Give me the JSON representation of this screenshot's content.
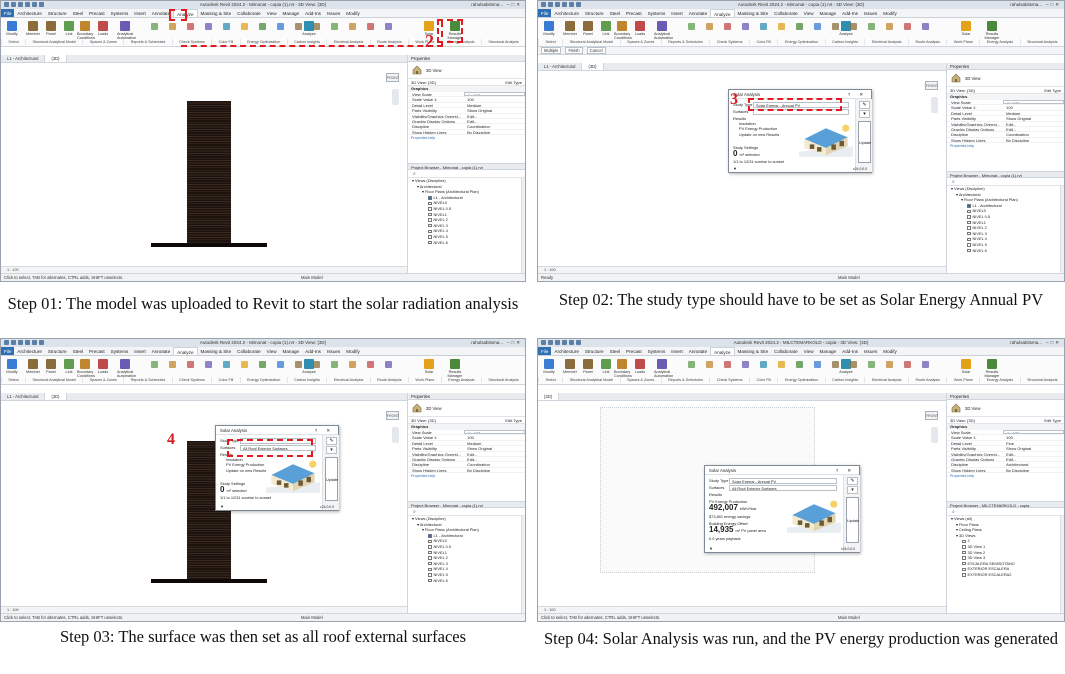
{
  "shared": {
    "window_title": "Autodesk Revit 2024.2 - Mimonat - copia (1).rvt - 3D View: {3D}",
    "user": "rahulsabitsma...",
    "menu_tabs": [
      "File",
      "Architecture",
      "Structure",
      "Steel",
      "Precast",
      "Systems",
      "Insert",
      "Annotate",
      "Analyze",
      "Massing & Site",
      "Collaborate",
      "View",
      "Manage",
      "Add-Ins",
      "Issues",
      "Modify"
    ],
    "ribbon_buttons": [
      "Modify",
      "Member",
      "Panel",
      "Link",
      "Boundary Conditions",
      "Loads",
      "Analytical Automation",
      "Analyze",
      "Solar",
      "Results Manager"
    ],
    "ribbon_groups": [
      "Select",
      "Structural Analytical Model",
      "Spaces & Zones",
      "Reports & Schedules",
      "Check Systems",
      "Color Fill",
      "Energy Optimization",
      "Carbon Insights",
      "Electrical Analysis",
      "Route Analysis",
      "Work Plane",
      "Energy Analysis",
      "Structural Analysis"
    ],
    "view_tabs": [
      "L1 - Architectural",
      "{3D}"
    ],
    "status_text": "Click to select, TAB for alternates, CTRL adds, SHIFT unselects.",
    "view_scale": "1 : 100",
    "main_model": "Main Model",
    "properties_title": "Properties",
    "type_name": "3D View",
    "selector": "3D View: {3D}",
    "edit_type": "Edit Type",
    "graphics_label": "Graphics",
    "graphics_rows": [
      {
        "k": "View Scale",
        "v": "1 : 100"
      },
      {
        "k": "Scale Value 1:",
        "v": "100"
      },
      {
        "k": "Detail Level",
        "v": "Medium"
      },
      {
        "k": "Parts Visibility",
        "v": "Show Original"
      },
      {
        "k": "Visibility/Graphics Overrid...",
        "v": "Edit..."
      },
      {
        "k": "Graphic Display Options",
        "v": "Edit..."
      },
      {
        "k": "Discipline",
        "v": "Coordination"
      },
      {
        "k": "Show Hidden Lines",
        "v": "By Discipline"
      }
    ],
    "properties_help": "Properties help",
    "apply": "Apply",
    "browser_title": "Project Browser - Mimonat - copia (1).rvt",
    "tree": [
      "Views (Discipline)",
      "Architectural",
      "Floor Plans (Architectural Plan)",
      "L1 - Architectural",
      "NIVEL0",
      "NIVEL 0.5",
      "NIVEL1",
      "NIVEL 2",
      "NIVEL 3",
      "NIVEL 4",
      "NIVEL 5",
      "NIVEL 6"
    ],
    "cube_label": "FRONT",
    "ready": "Ready",
    "options_bar": [
      "Multiple",
      "Finish",
      "Cancel"
    ]
  },
  "dialog": {
    "title": "Solar Analysis",
    "study_type_label": "Study Type",
    "study_type_value": "Solar Energy - Annual PV",
    "surfaces_label": "Surfaces",
    "surfaces_value": "All Roof Exterior Surfaces",
    "results_label": "Results",
    "insolation": "Insolation",
    "pv_energy": "PV Energy Production",
    "update_results": "Update on new Results",
    "study_settings": "Study Settings",
    "selected": "0",
    "selected_unit": "m² selected",
    "period": "1/1 to 12/31 sunrise to sunset",
    "update_btn": "Update",
    "version": "v24.0.0.0",
    "pv_energy_production": "PV Energy Production",
    "kwh_value": "492,007",
    "kwh_unit": "kWh/Year",
    "savings": "$73,801 energy savings",
    "building_energy_offset": "Building Energy Offset",
    "area_value": "14,935",
    "area_unit": "m² PV panel area",
    "payback": "0.0 years payback"
  },
  "step4": {
    "window_title": "Autodesk Revit 2024.2 - MILCTEMARKOLD - copia - 3D View: {3D}",
    "browser_title": "Project Browser - MILCTEMARKOLD - copia",
    "graphics_rows": [
      {
        "k": "View Scale",
        "v": "1 : 100"
      },
      {
        "k": "Scale Value 1:",
        "v": "100"
      },
      {
        "k": "Detail Level",
        "v": "Fine"
      },
      {
        "k": "Parts Visibility",
        "v": "Show Original"
      },
      {
        "k": "Visibility/Graphics Overrid...",
        "v": "Edit..."
      },
      {
        "k": "Graphic Display Options",
        "v": "Edit..."
      },
      {
        "k": "Discipline",
        "v": "Architectural"
      },
      {
        "k": "Show Hidden Lines",
        "v": "By Discipline"
      }
    ],
    "tree": [
      "Views (all)",
      "Floor Plans",
      "Ceiling Plans",
      "3D Views",
      "2",
      "3D View 1",
      "3D View 2",
      "3D View 3",
      "ESCALERA SEMISOTANO",
      "EXTERIOR ESCALERA",
      "EXTERIOR ESCALERA2"
    ]
  },
  "markers": {
    "m2": "2",
    "m3": "3",
    "m4": "4"
  },
  "captions": {
    "step1": "Step 01: The model was uploaded to Revit to start the solar radiation analysis",
    "step2": "Step 02: The study type should have to be set as Solar Energy Annual PV",
    "step3": "Step 03:  The surface was then set as all roof external surfaces",
    "step4": "Step 04:  Solar Analysis was run, and the PV energy production was generated"
  },
  "colors": {
    "accent": "#2f6fb2",
    "marker": "#e01b22",
    "building": "#1d1410"
  }
}
